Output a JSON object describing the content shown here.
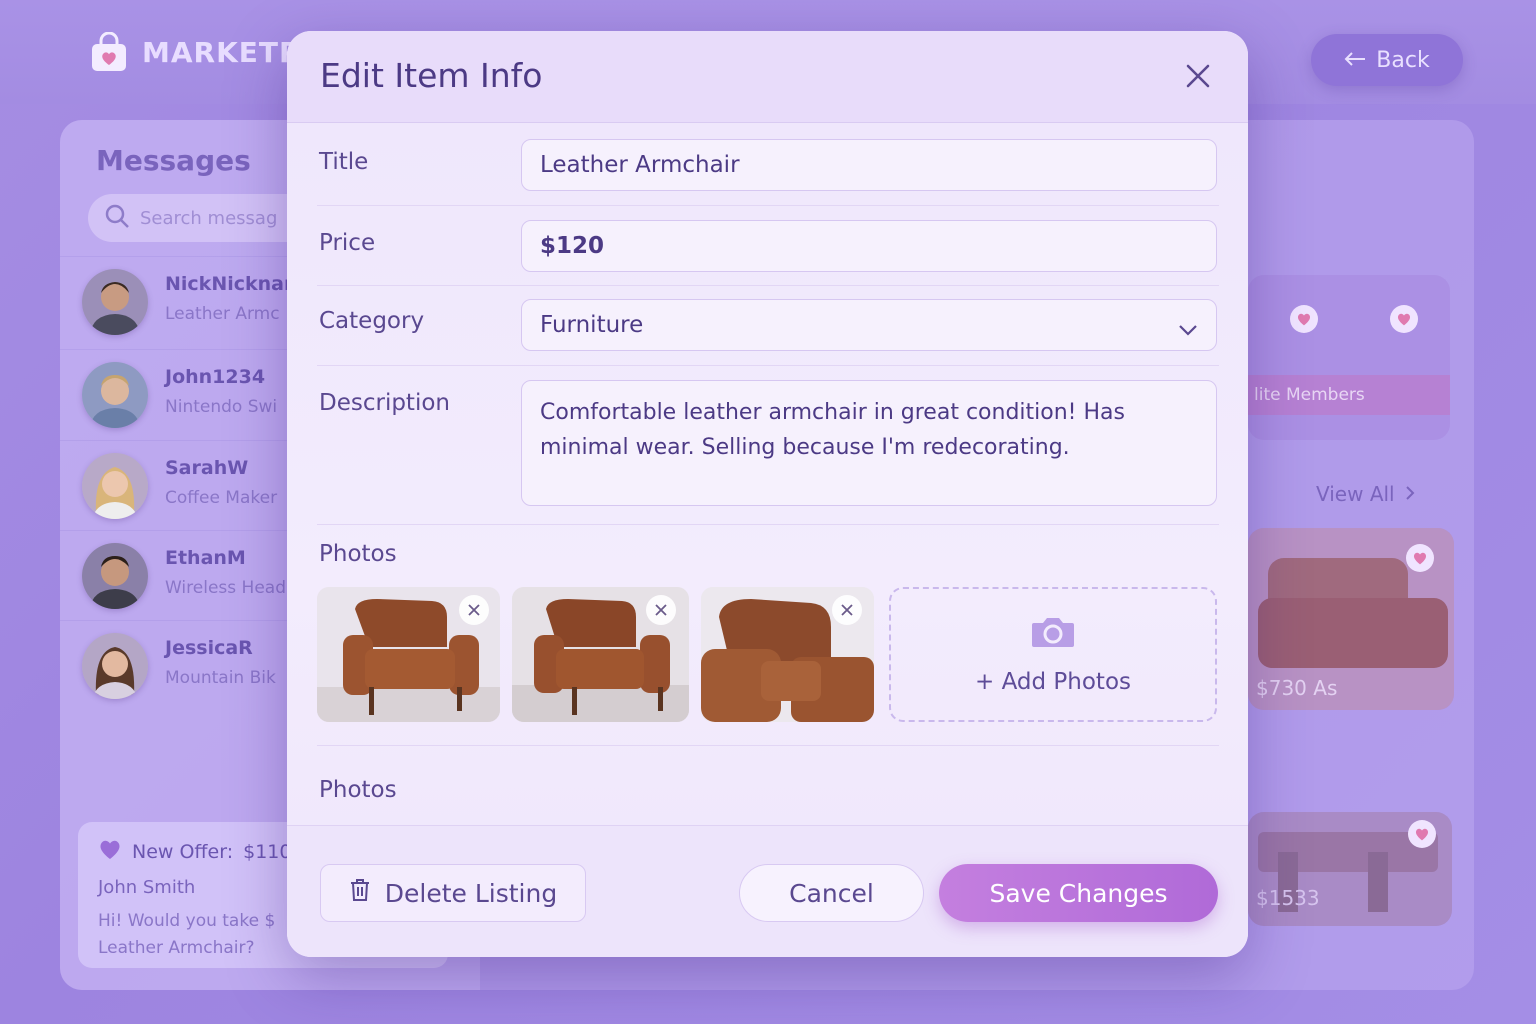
{
  "app": {
    "logo_text": "MARKETPL",
    "back_label": "Back"
  },
  "messages": {
    "title": "Messages",
    "search_placeholder": "Search messag",
    "conversations": [
      {
        "name": "NickNicknar",
        "preview": "Leather Armc"
      },
      {
        "name": "John1234",
        "preview": "Nintendo Swi"
      },
      {
        "name": "SarahW",
        "preview": "Coffee Maker"
      },
      {
        "name": "EthanM",
        "preview": "Wireless Head"
      },
      {
        "name": "JessicaR",
        "preview": "Mountain Bik"
      }
    ],
    "offer": {
      "title": "New Offer:",
      "amount": "$110",
      "sender": "John Smith",
      "text_line1": "Hi! Would you take $",
      "text_line2": "Leather Armchair?"
    }
  },
  "right_panel": {
    "card1_label": "lite Members",
    "view_all": "View All",
    "card2_price": "$730 As",
    "card3_price": "$1533"
  },
  "modal": {
    "title": "Edit Item Info",
    "fields": {
      "title_label": "Title",
      "title_value": "Leather Armchair",
      "price_label": "Price",
      "price_value": "$120",
      "category_label": "Category",
      "category_value": "Furniture",
      "description_label": "Description",
      "description_value": "Comfortable leather armchair in great condition! Has minimal wear. Selling because I'm redecorating."
    },
    "photos_label": "Photos",
    "add_photos_label": "+ Add Photos",
    "photos_label_2": "Photos",
    "buttons": {
      "delete": "Delete Listing",
      "cancel": "Cancel",
      "save": "Save Changes"
    }
  },
  "colors": {
    "accent": "#b06ad8",
    "modal_bg": "#f3ecfd",
    "heading": "#4c3a85"
  }
}
